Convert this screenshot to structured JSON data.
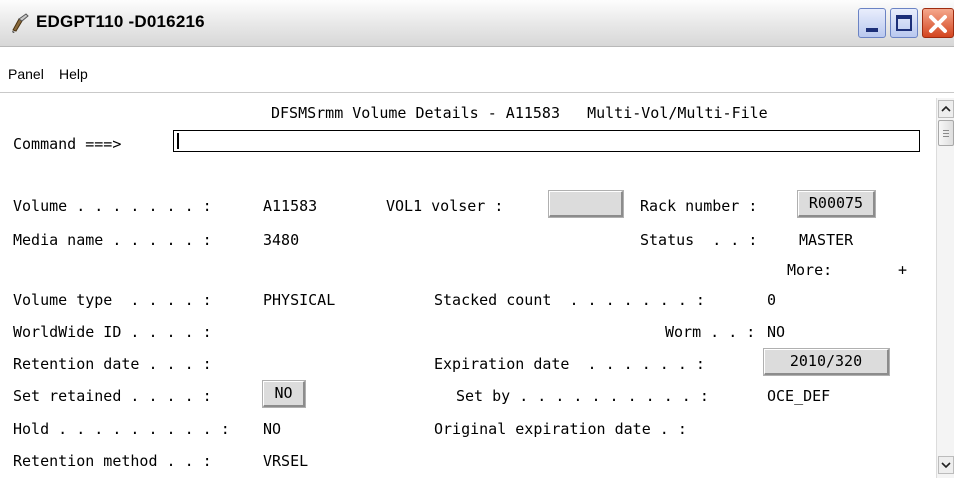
{
  "window": {
    "title": "EDGPT110 -D016216",
    "controls": [
      "minimize-icon",
      "maximize-icon",
      "close-icon"
    ]
  },
  "menu": {
    "items": [
      "Panel",
      "Help"
    ]
  },
  "panel": {
    "header": "DFSMSrmm Volume Details - A11583   Multi-Vol/Multi-File",
    "command_label": "Command ===>",
    "command_value": "",
    "more_label": "More:",
    "more_indicator": "+"
  },
  "fields": {
    "volume_label": "Volume . . . . . . . :",
    "volume_value": "A11583",
    "vol1_label": "VOL1 volser :",
    "vol1_value": "",
    "rack_label": "Rack number :",
    "rack_value": "R00075",
    "media_label": "Media name . . . . . :",
    "media_value": "3480",
    "status_label": "Status  . . :",
    "status_value": "MASTER",
    "voltype_label": "Volume type  . . . . :",
    "voltype_value": "PHYSICAL",
    "stacked_label": "Stacked count  . . . . . . . :",
    "stacked_value": "0",
    "worldwide_label": "WorldWide ID . . . . :",
    "worm_label": "Worm . . :",
    "worm_value": "NO",
    "retention_label": "Retention date . . . :",
    "expiration_label": "Expiration date  . . . . . . :",
    "expiration_value": "2010/320",
    "setretained_label": "Set retained . . . . :",
    "setretained_value": "NO",
    "setby_label": "Set by . . . . . . . . . . :",
    "setby_value": "OCE_DEF",
    "hold_label": "Hold . . . . . . . . . :",
    "hold_value": "NO",
    "origexp_label": "Original expiration date . :",
    "retmethod_label": "Retention method . . :",
    "retmethod_value": "VRSEL"
  },
  "scrollbar": {
    "up": "up-arrow-icon",
    "down": "down-arrow-icon",
    "thumb_grip": "grip-icon"
  }
}
